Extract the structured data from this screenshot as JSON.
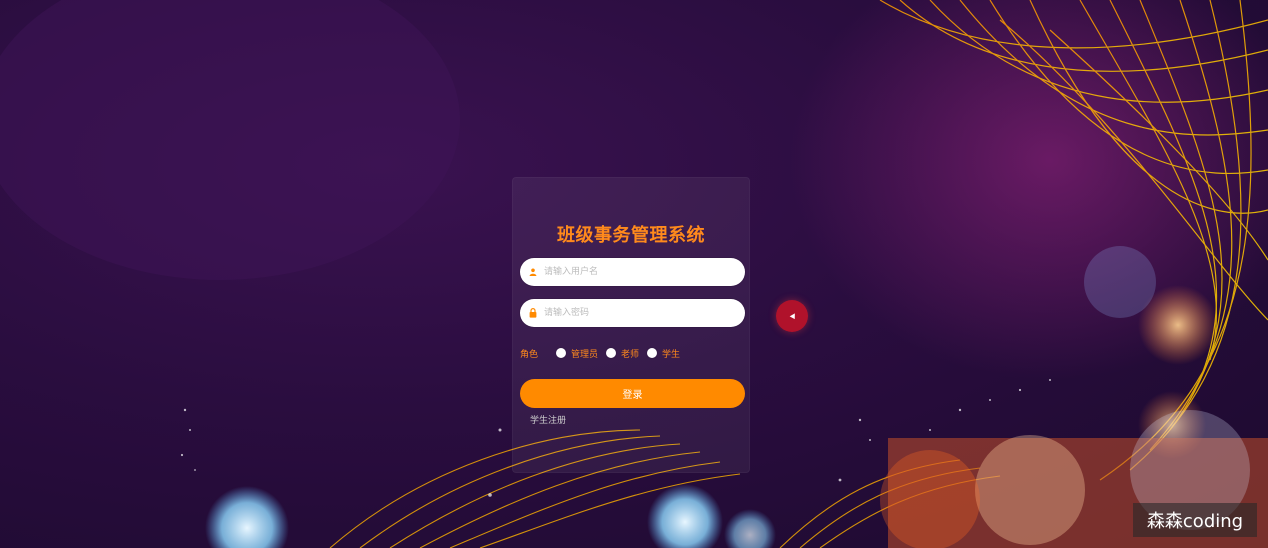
{
  "login": {
    "title": "班级事务管理系统",
    "username": {
      "placeholder": "请输入用户名",
      "icon": "user-icon"
    },
    "password": {
      "placeholder": "请输入密码",
      "icon": "lock-icon"
    },
    "role": {
      "label": "角色",
      "options": [
        {
          "label": "管理员"
        },
        {
          "label": "老师"
        },
        {
          "label": "学生"
        }
      ]
    },
    "login_label": "登录",
    "register_label": "学生注册"
  },
  "watermark": "森森coding",
  "colors": {
    "accent": "#ff8a00",
    "title": "#ff8a1c",
    "background": "#2a0d3f"
  }
}
